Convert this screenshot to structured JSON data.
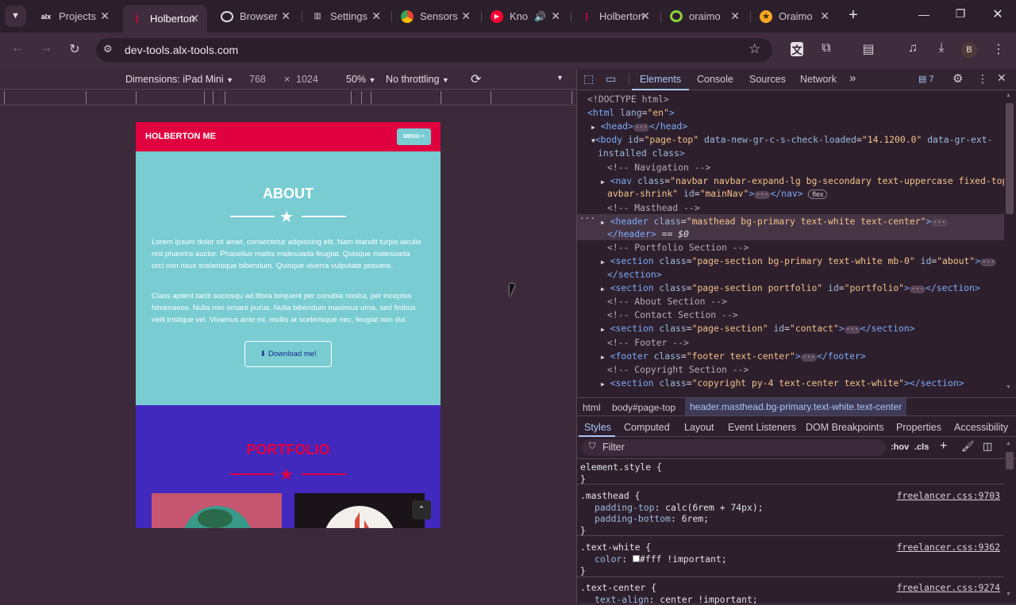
{
  "tabs": [
    {
      "title": "Projects"
    },
    {
      "title": "Holberton"
    },
    {
      "title": "Browser"
    },
    {
      "title": "Settings"
    },
    {
      "title": "Sensors"
    },
    {
      "title": "Kno"
    },
    {
      "title": "Holberton"
    },
    {
      "title": "oraimo"
    },
    {
      "title": "Oraimo"
    }
  ],
  "address": {
    "url": "dev-tools.alx-tools.com"
  },
  "profile": {
    "initial": "B"
  },
  "device_toolbar": {
    "dimensions_label": "Dimensions: iPad Mini",
    "width": "768",
    "times": "×",
    "height": "1024",
    "zoom": "50%",
    "throttling": "No throttling"
  },
  "site": {
    "brand": "HOLBERTON ME",
    "menu": "MENU",
    "about_title": "ABOUT",
    "para1": "Lorem ipsum dolor sit amet, consectetur adipiscing elit. Nam blandit turpis iaculis nisl pharetra auctor. Phasellus mattis malesuada feugiat. Quisque malesuada orci non risus scelerisque bibendum. Quisque viverra vulputate posuere.",
    "para2": "Class aptent taciti sociosqu ad litora torquent per conubia nostra, per inceptos himenaeos. Nulla non ornare purus. Nulla bibendum maximus urna, sed finibus velit tristique vel. Vivamus ante mi, mollis at scelerisque nec, feugiat non dui.",
    "download": "Download me!",
    "portfolio_title": "PORTFOLIO"
  },
  "devtools": {
    "tabs": [
      "Elements",
      "Console",
      "Sources",
      "Network"
    ],
    "issues_count": "7",
    "dom_lines": {
      "l1": "<!DOCTYPE html>",
      "html_open": "<html",
      "html_attr": "lang",
      "html_val": "\"en\"",
      "head": "<head>",
      "head_close": "</head>",
      "body_open": "<body",
      "body_id": "id",
      "body_id_val": "\"page-top\"",
      "body_attr2": "data-new-gr-c-s-check-loaded",
      "body_attr2_val": "\"14.1200.0\"",
      "body_attr3": "data-gr-ext-",
      "body_attr3b": "installed",
      "body_class": "class",
      "cm_nav": "<!-- Navigation -->",
      "nav_open": "<nav",
      "nav_class": "class",
      "nav_class_val": "\"navbar navbar-expand-lg bg-secondary text-uppercase fixed-top n",
      "nav_class_val2": "avbar-shrink\"",
      "nav_id": "id",
      "nav_id_val": "\"mainNav\"",
      "nav_close": "</nav>",
      "flex_badge": "flex",
      "cm_masthead": "<!-- Masthead -->",
      "header_open": "<header",
      "header_class": "class",
      "header_class_val": "\"masthead bg-primary text-white text-center\"",
      "header_close": "</header>",
      "eq": "== $0",
      "cm_portfolio": "<!-- Portfolio Section -->",
      "sec1_open": "<section",
      "sec1_class": "class",
      "sec1_class_val": "\"page-section bg-primary text-white mb-0\"",
      "sec1_id": "id",
      "sec1_id_val": "\"about\"",
      "sec_close": "</section>",
      "sec2_class_val": "\"page-section portfolio\"",
      "sec2_id_val": "\"portfolio\"",
      "cm_about": "<!-- About Section -->",
      "cm_contact": "<!-- Contact Section -->",
      "sec3_class_val": "\"page-section\"",
      "sec3_id_val": "\"contact\"",
      "cm_footer": "<!-- Footer -->",
      "footer_open": "<footer",
      "footer_class_val": "\"footer text-center\"",
      "footer_close": "</footer>",
      "cm_copyright": "<!-- Copyright Section -->",
      "sec4_class_val": "\"copyright py-4 text-center text-white\""
    },
    "breadcrumbs": [
      "html",
      "body#page-top",
      "header.masthead.bg-primary.text-white.text-center"
    ],
    "style_tabs": [
      "Styles",
      "Computed",
      "Layout",
      "Event Listeners",
      "DOM Breakpoints",
      "Properties",
      "Accessibility"
    ],
    "filter_placeholder": "Filter",
    "hov": ":hov",
    "cls": ".cls",
    "rules": {
      "r0_sel": "element.style {",
      "close": "}",
      "r1_sel": ".masthead {",
      "r1_src": "freelancer.css:9703",
      "r1_p1": "padding-top",
      "r1_v1": "calc(6rem + 74px);",
      "r1_p2": "padding-bottom",
      "r1_v2": "6rem;",
      "r2_sel": ".text-white {",
      "r2_src": "freelancer.css:9362",
      "r2_p1": "color",
      "r2_v1": "#fff !important;",
      "r3_sel": ".text-center {",
      "r3_src": "freelancer.css:9274",
      "r3_p1": "text-align",
      "r3_v1": "center !important;"
    }
  }
}
